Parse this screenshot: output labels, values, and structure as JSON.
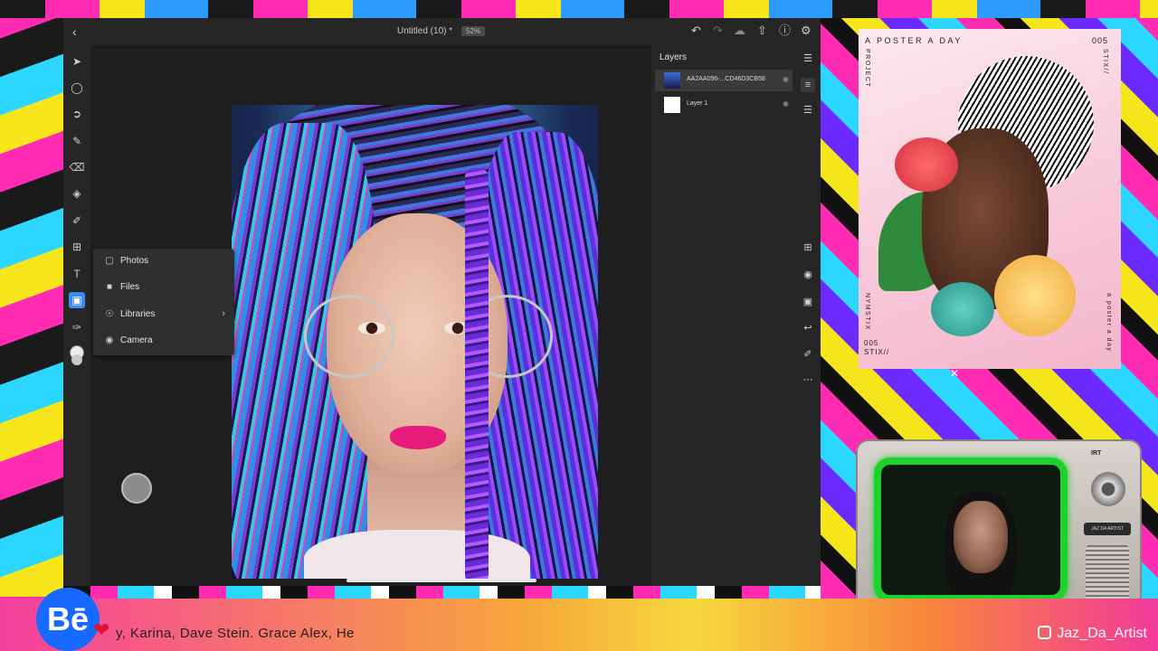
{
  "app": {
    "back_icon": "chevron-left-icon",
    "document_title": "Untitled (10) *",
    "zoom_level": "52%",
    "top_icons": [
      "undo-icon",
      "redo-icon",
      "cloud-icon",
      "share-icon",
      "help-icon",
      "settings-icon"
    ]
  },
  "tools": [
    "select-icon",
    "transform-icon",
    "lasso-icon",
    "brush-icon",
    "eraser-icon",
    "fill-icon",
    "eyedropper-icon",
    "crop-icon",
    "type-icon",
    "place-image-icon",
    "sampler-icon"
  ],
  "import_menu": {
    "items": [
      {
        "label": "Photos",
        "icon": "photos-icon"
      },
      {
        "label": "Files",
        "icon": "folder-icon"
      },
      {
        "label": "Libraries",
        "icon": "libraries-icon",
        "has_submenu": true
      },
      {
        "label": "Camera",
        "icon": "camera-icon"
      }
    ]
  },
  "layers": {
    "title": "Layers",
    "items": [
      {
        "name": "AA2AA096-...CD46D3CB58",
        "selected": true
      },
      {
        "name": "Layer 1",
        "selected": false
      }
    ]
  },
  "right_rail": [
    "layers-icon",
    "layer-props-icon",
    "adjust-icon",
    "add-layer-icon",
    "visibility-icon",
    "mask-icon",
    "merge-icon",
    "clip-icon",
    "more-icon"
  ],
  "poster": {
    "header": "A POSTER A DAY",
    "number": "005",
    "vertical_left": "PROJECT",
    "vertical_right": "STIX//",
    "vertical_left_bottom": "NYMSTIX",
    "vertical_right_bottom": "a poster a day",
    "footer_line1": "005",
    "footer_line2": "STIX//"
  },
  "tv": {
    "brand_top": "IRT",
    "brand_plate": "JAZ DA ARTIST"
  },
  "ticker": {
    "text": "y, Karina, Dave Stein.   Grace Alex,  He",
    "behance_logo": "Bē",
    "handle": "Jaz_Da_Artist"
  },
  "colors": {
    "accent": "#3d8bf2",
    "tv_glow": "#1fd12c",
    "behance": "#1769ff"
  }
}
